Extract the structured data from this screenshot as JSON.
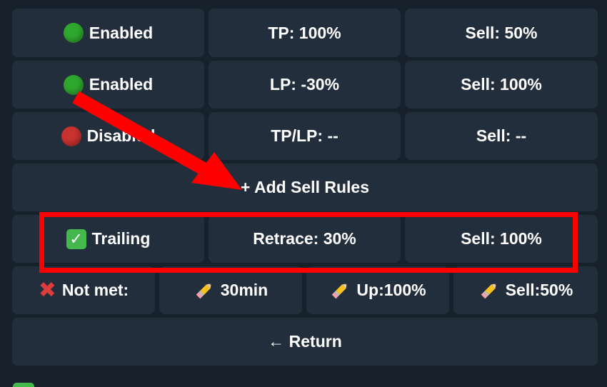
{
  "keyboard": {
    "rows": [
      {
        "buttons": [
          {
            "icon": "green-circle-icon",
            "color": "#2fa82f",
            "label": "Enabled"
          },
          {
            "label": "TP: 100%"
          },
          {
            "label": "Sell: 50%"
          }
        ]
      },
      {
        "buttons": [
          {
            "icon": "green-circle-icon",
            "color": "#2fa82f",
            "label": "Enabled"
          },
          {
            "label": "LP: -30%"
          },
          {
            "label": "Sell: 100%"
          }
        ]
      },
      {
        "buttons": [
          {
            "icon": "red-circle-icon",
            "color": "#c8322f",
            "label": "Disabled"
          },
          {
            "label": "TP/LP: --"
          },
          {
            "label": "Sell: --"
          }
        ]
      },
      {
        "buttons": [
          {
            "label": "+ Add Sell Rules"
          }
        ]
      },
      {
        "buttons": [
          {
            "icon": "check-mark-icon",
            "label": "Trailing"
          },
          {
            "label": "Retrace: 30%"
          },
          {
            "label": "Sell: 100%"
          }
        ]
      },
      {
        "buttons": [
          {
            "icon": "cross-mark-icon",
            "label": "Not met:"
          },
          {
            "icon": "pencil-icon",
            "label": "30min"
          },
          {
            "icon": "pencil-icon",
            "label": "Up:100%"
          },
          {
            "icon": "pencil-icon",
            "label": "Sell:50%"
          }
        ]
      },
      {
        "buttons": [
          {
            "label": "← Return"
          }
        ]
      }
    ]
  },
  "annotations": {
    "arrow_color": "#ff0000",
    "highlight_color": "#ff0000"
  }
}
